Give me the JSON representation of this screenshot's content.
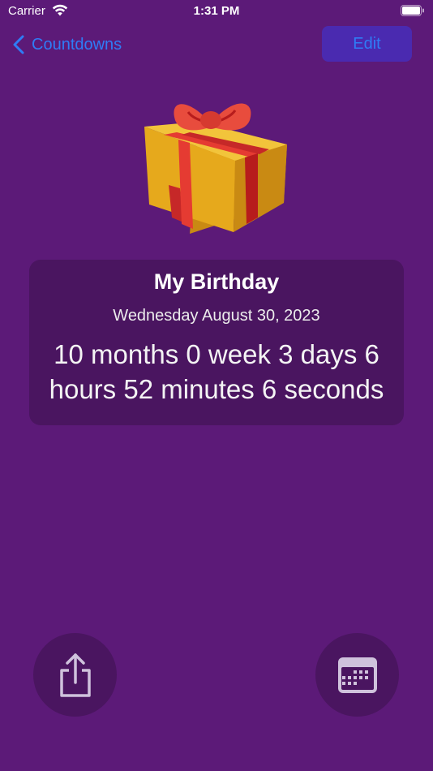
{
  "status_bar": {
    "carrier": "Carrier",
    "time": "1:31 PM"
  },
  "nav": {
    "back_label": "Countdowns",
    "edit_label": "Edit"
  },
  "event": {
    "title": "My Birthday",
    "date": "Wednesday August 30, 2023",
    "countdown": "10 months 0 week 3 days 6 hours 52 minutes 6 seconds"
  },
  "icons": {
    "event": "gift-icon",
    "share": "share-icon",
    "calendar": "calendar-icon"
  },
  "colors": {
    "background": "#5c1a78",
    "card": "#4a1560",
    "accent": "#2f7cf6",
    "edit_button": "#4a2ab0"
  }
}
